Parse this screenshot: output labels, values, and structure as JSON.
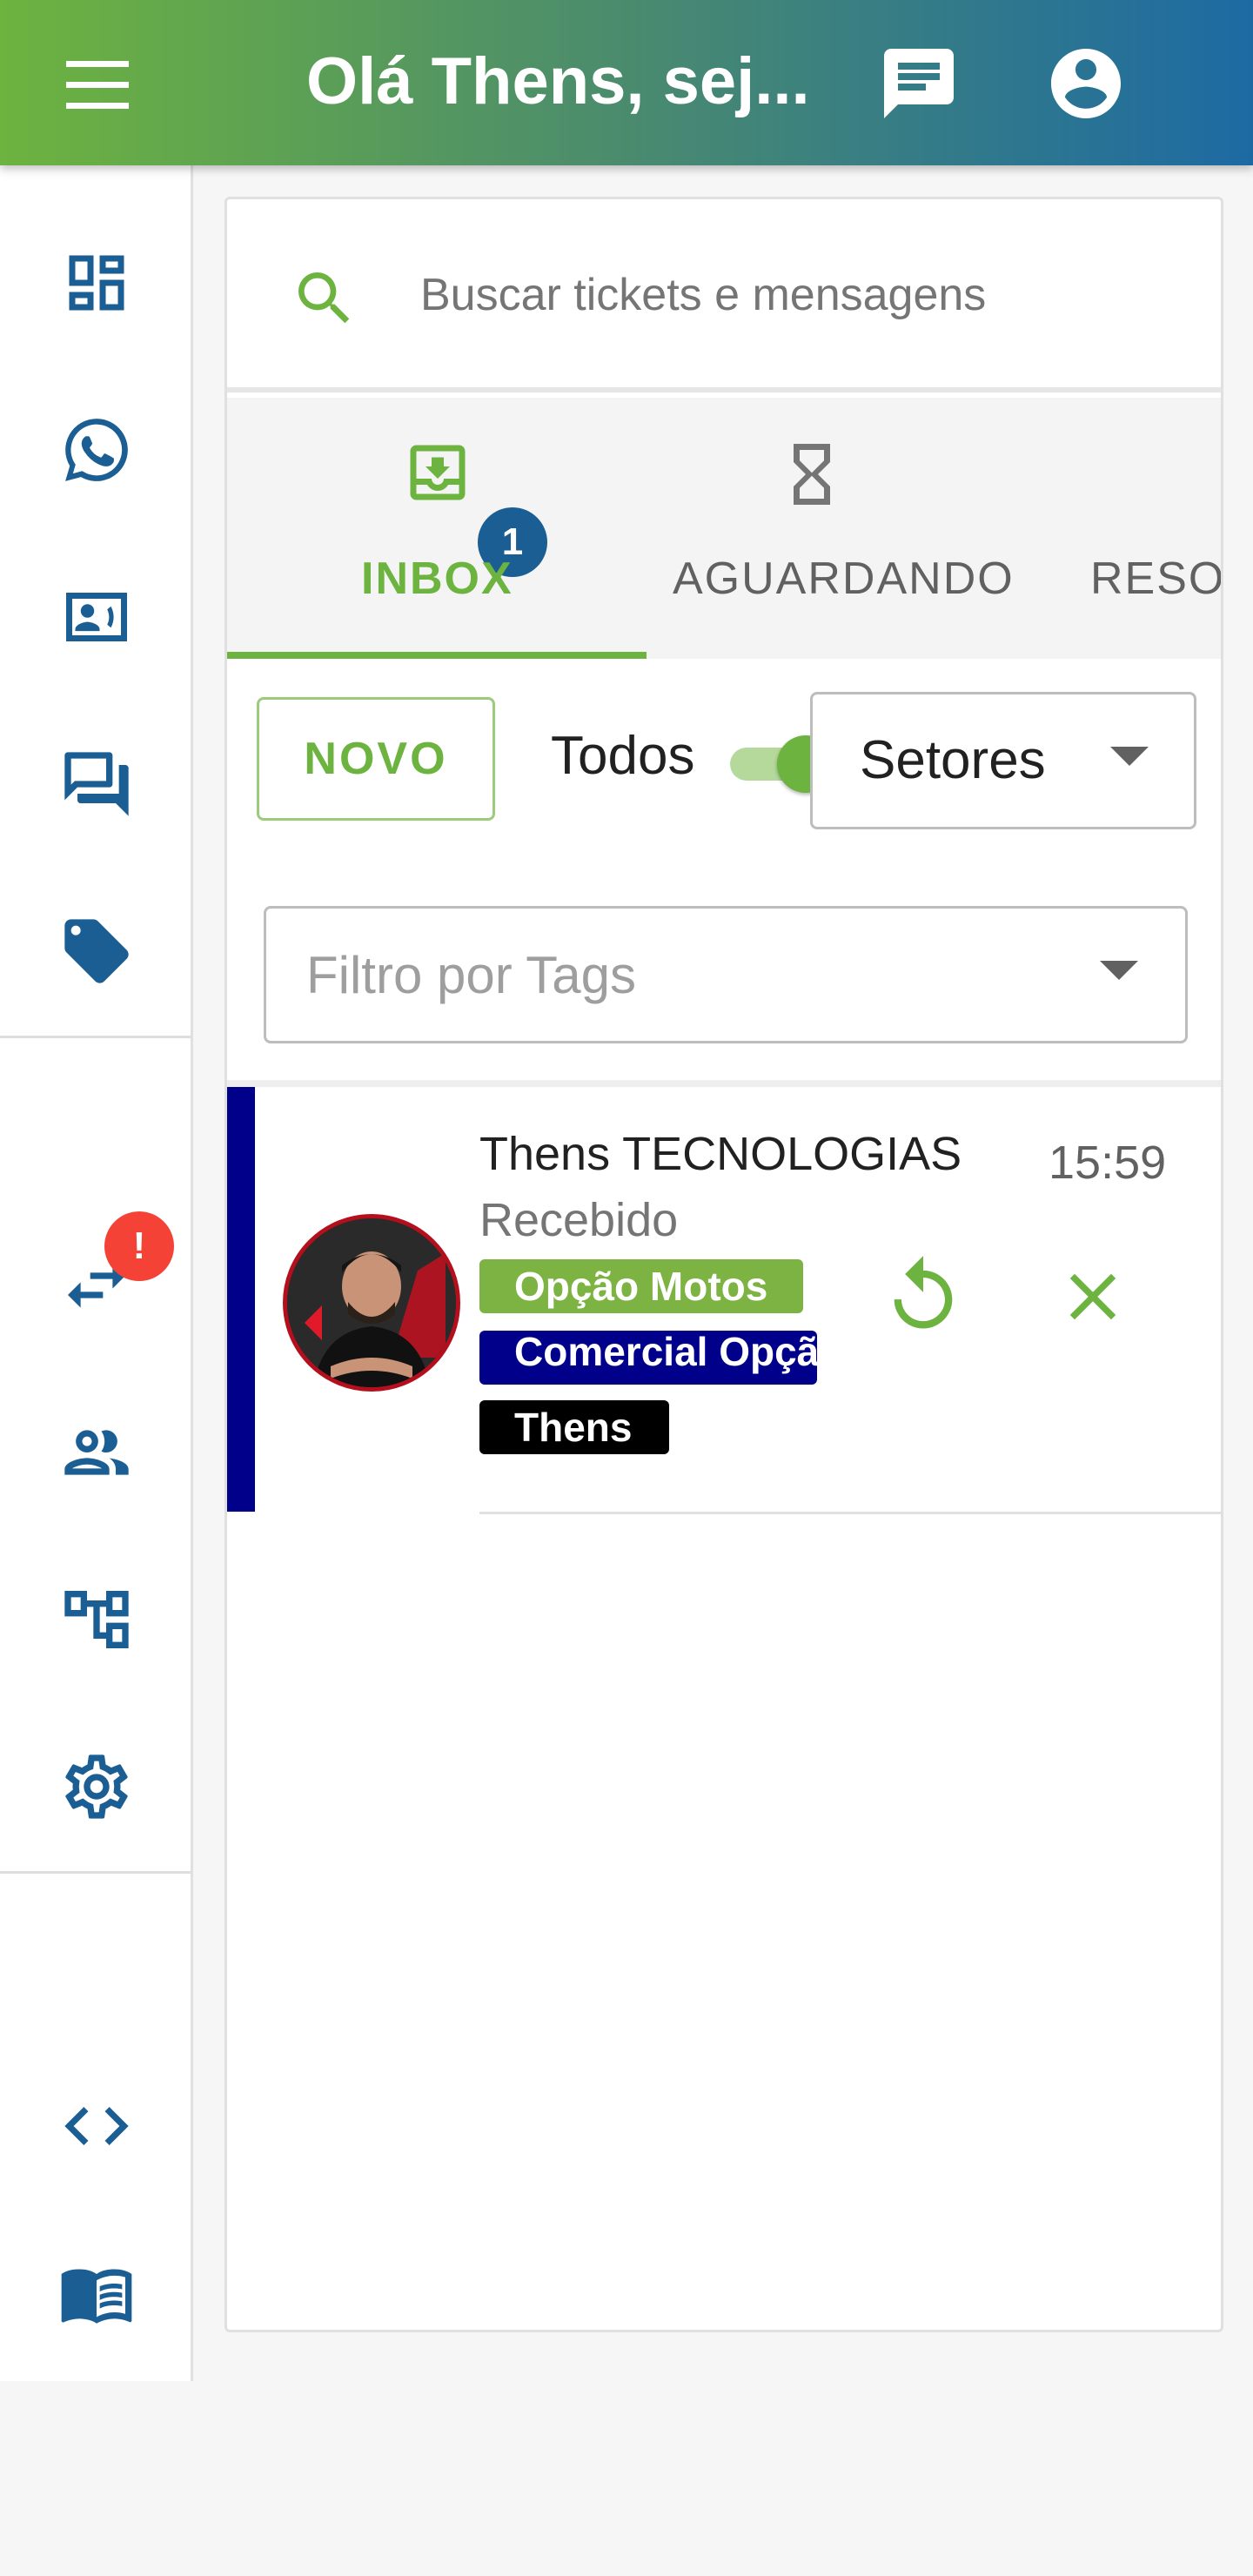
{
  "header": {
    "title": "Olá Thens, sej...",
    "menu_icon": "menu-icon",
    "chat_icon": "chat-icon",
    "account_icon": "account-circle-icon",
    "gradient": [
      "#6db33f",
      "#1d6aa3"
    ]
  },
  "sidebar": {
    "items": [
      {
        "icon": "dashboard-icon"
      },
      {
        "icon": "whatsapp-icon"
      },
      {
        "icon": "contacts-icon"
      },
      {
        "icon": "forum-icon"
      },
      {
        "icon": "tag-icon"
      },
      {
        "icon": "swap-icon",
        "badge": "!"
      },
      {
        "icon": "users-icon"
      },
      {
        "icon": "flow-icon"
      },
      {
        "icon": "settings-icon"
      },
      {
        "icon": "code-icon"
      },
      {
        "icon": "book-icon"
      }
    ],
    "accent": "#1b5e94"
  },
  "search": {
    "placeholder": "Buscar tickets e mensagens"
  },
  "tabs": [
    {
      "label": "INBOX",
      "icon": "inbox-download-icon",
      "badge": "1",
      "active": true
    },
    {
      "label": "AGUARDANDO",
      "icon": "hourglass-icon"
    },
    {
      "label": "RESOLVIDOS",
      "icon": ""
    }
  ],
  "filters": {
    "new_button": "NOVO",
    "all_label": "Todos",
    "all_toggle_on": true,
    "sectors_value": "Setores",
    "tags_placeholder": "Filtro por Tags"
  },
  "tickets": [
    {
      "name": "Thens TECNOLOGIAS",
      "status": "Recebido",
      "time": "15:59",
      "stripe_color": "#00008b",
      "tags": [
        {
          "label": "Opção Motos",
          "color": "#7cb342"
        },
        {
          "label": "Comercial Opção Motos",
          "color": "#00008b"
        },
        {
          "label": "Thens",
          "color": "#000000"
        }
      ]
    }
  ]
}
